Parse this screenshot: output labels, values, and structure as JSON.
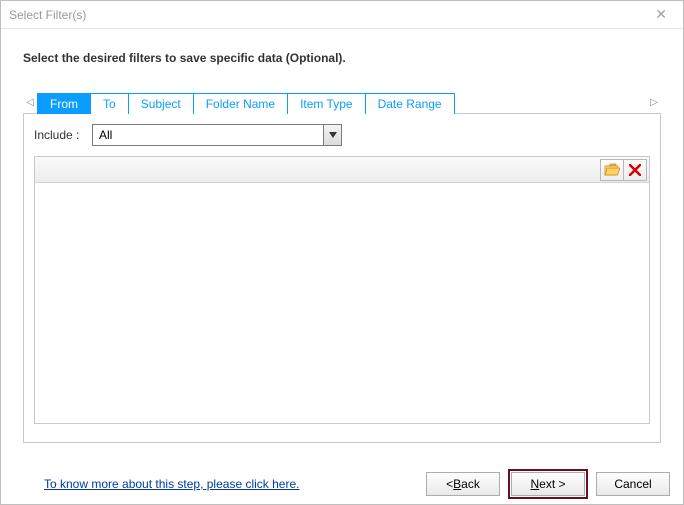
{
  "window": {
    "title": "Select Filter(s)"
  },
  "instruction": "Select the desired filters to save specific data (Optional).",
  "tabs": {
    "items": [
      {
        "label": "From",
        "active": true
      },
      {
        "label": "To",
        "active": false
      },
      {
        "label": "Subject",
        "active": false
      },
      {
        "label": "Folder Name",
        "active": false
      },
      {
        "label": "Item Type",
        "active": false
      },
      {
        "label": "Date Range",
        "active": false
      }
    ],
    "scroll_left": "◁",
    "scroll_right": "▷"
  },
  "include": {
    "label": "Include :",
    "value": "All"
  },
  "toolbar": {
    "browse_icon": "folder-open-icon",
    "remove_icon": "delete-icon"
  },
  "footer": {
    "help_text": "To know more about this step, please click here.",
    "back_label_prefix": "< ",
    "back_label_u": "B",
    "back_label_rest": "ack",
    "next_label_u": "N",
    "next_label_rest": "ext >",
    "cancel_label": "Cancel"
  }
}
